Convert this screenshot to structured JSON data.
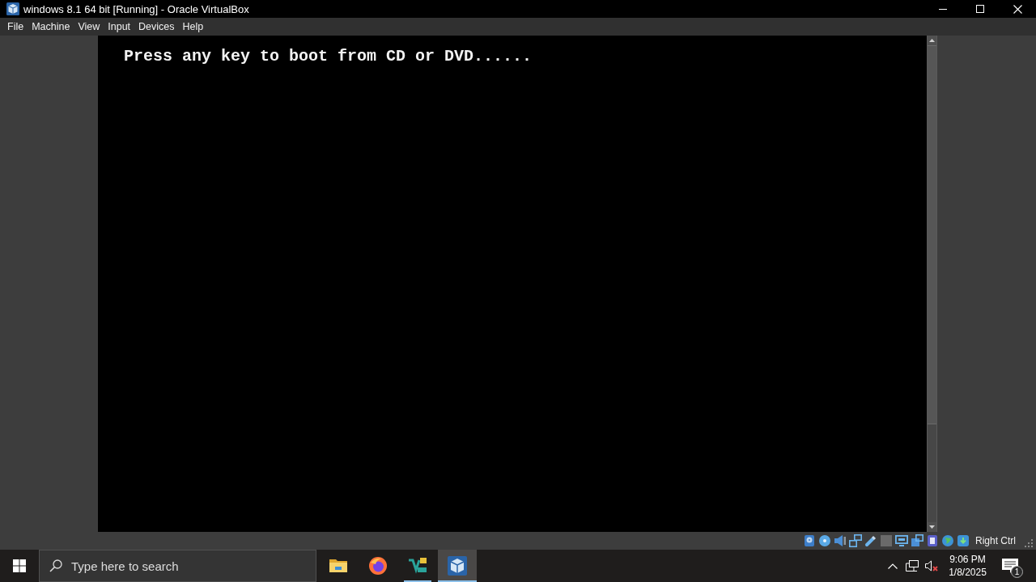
{
  "window": {
    "title": "windows 8.1 64 bit [Running] - Oracle VirtualBox"
  },
  "menu": [
    "File",
    "Machine",
    "View",
    "Input",
    "Devices",
    "Help"
  ],
  "vm_screen": {
    "text": "Press any key to boot from CD or DVD......"
  },
  "status_bar": {
    "host_key": "Right Ctrl"
  },
  "taskbar": {
    "search": {
      "placeholder": "Type here to search"
    },
    "apps": [
      {
        "kind": "folder",
        "running": false,
        "selected": false
      },
      {
        "kind": "browser",
        "running": false,
        "selected": false
      },
      {
        "kind": "editor",
        "running": true,
        "selected": false
      },
      {
        "kind": "virtualbox",
        "running": true,
        "selected": true
      }
    ],
    "clock": {
      "time": "9:06 PM",
      "date": "1/8/2025"
    },
    "notifications": {
      "count": "1"
    }
  }
}
